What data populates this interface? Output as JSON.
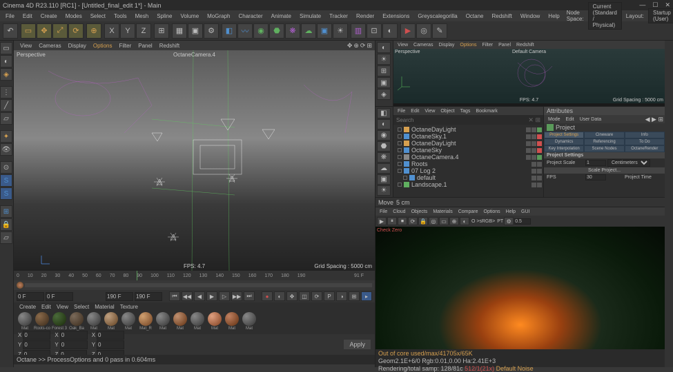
{
  "titlebar": {
    "text": "Cinema 4D R23.110 [RC1] - [Untitled_final_edit 1*] - Main"
  },
  "mainmenu": {
    "items": [
      "File",
      "Edit",
      "Create",
      "Modes",
      "Select",
      "Tools",
      "Mesh",
      "Spline",
      "Volume",
      "MoGraph",
      "Character",
      "Animate",
      "Simulate",
      "Tracker",
      "Render",
      "Extensions",
      "Greyscalegorilla",
      "Octane",
      "Redshift",
      "Window",
      "Help"
    ],
    "nodespace_label": "Node Space:",
    "nodespace_value": "Current (Standard / Physical)",
    "layout_label": "Layout:",
    "layout_value": "Startup (User)"
  },
  "viewport_menu": {
    "items": [
      "View",
      "Cameras",
      "Display",
      "Options",
      "Filter",
      "Panel",
      "Redshift"
    ]
  },
  "viewport": {
    "perspective": "Perspective",
    "camera": "OctaneCamera.4",
    "fps": "FPS: 4.7",
    "grid": "Grid Spacing : 5000 cm"
  },
  "mini_viewport": {
    "perspective": "Perspective",
    "camera": "Default Camera",
    "fps": "FPS: 4.7",
    "grid": "Grid Spacing : 5000 cm",
    "menu": [
      "View",
      "Cameras",
      "Display",
      "Options",
      "Filter",
      "Panel",
      "Redshift"
    ]
  },
  "objects": {
    "menu": [
      "File",
      "Edit",
      "View",
      "Object",
      "Tags",
      "Bookmark"
    ],
    "search_placeholder": "Search",
    "items": [
      {
        "name": "OctaneDayLight"
      },
      {
        "name": "OctaneSky.1"
      },
      {
        "name": "OctaneDayLight"
      },
      {
        "name": "OctaneSky"
      },
      {
        "name": "OctaneCamera.4"
      },
      {
        "name": "Roots"
      },
      {
        "name": "07 Log 2"
      },
      {
        "name": "default"
      },
      {
        "name": "Landscape.1"
      }
    ]
  },
  "attributes": {
    "title": "Attributes",
    "menu": [
      "Mode",
      "Edit",
      "User Data"
    ],
    "project": "Project",
    "tabs": [
      "Project Settings",
      "Cineware",
      "Info",
      "Dynamics",
      "Referencing",
      "To Do",
      "Key Interpolation",
      "Scene Nodes",
      "OctaneRender"
    ],
    "section": "Project Settings",
    "scale_label": "Project Scale",
    "scale_value": "1",
    "scale_unit": "Centimeters",
    "scale_btn": "Scale Project...",
    "fps_label": "FPS",
    "fps_value": "30",
    "time_label": "Project Time"
  },
  "move": {
    "label": "Move",
    "value": "5 cm"
  },
  "timeline": {
    "ticks": [
      "0",
      "10",
      "20",
      "30",
      "40",
      "50",
      "60",
      "70",
      "80",
      "90",
      "100",
      "110",
      "120",
      "130",
      "140",
      "150",
      "160",
      "170",
      "180",
      "190"
    ],
    "end": "91 F"
  },
  "playback": {
    "start": "0 F",
    "framein": "0 F",
    "frameout": "190 F",
    "end": "190 F"
  },
  "materials": {
    "menu": [
      "Create",
      "Edit",
      "View",
      "Select",
      "Material",
      "Texture"
    ],
    "thumbs": [
      "Mat",
      "Roots-co",
      "Forest 3",
      "Oak_Ba",
      "Mat",
      "Mat",
      "Mat",
      "Mat_R",
      "Mat",
      "Mat",
      "Mat",
      "Mat",
      "Mat",
      "Mat"
    ]
  },
  "coords": {
    "xyz": [
      "X",
      "Y",
      "Z"
    ],
    "zero": "0"
  },
  "apply": "Apply",
  "render": {
    "menu": [
      "File",
      "Cloud",
      "Objects",
      "Materials",
      "Compare",
      "Options",
      "Help",
      "GUI"
    ],
    "check": "Check Zero",
    "channel": "O >sRGB>",
    "pt": "PT",
    "spp": "0.5",
    "status1": "Out of core used/max/41705x/65K",
    "status2": "Geom2.1E+6/0     Rgb:0.01,0.00       Ha:2.41E+3",
    "status3_a": "Rendering/total samp: 128/81c",
    "status3_b": "512/1(21x)   ",
    "status3_c": "Default Noise"
  },
  "statusbar": {
    "text": "Octane >> ProcessOptions and 0 pass in 0.604ms"
  }
}
